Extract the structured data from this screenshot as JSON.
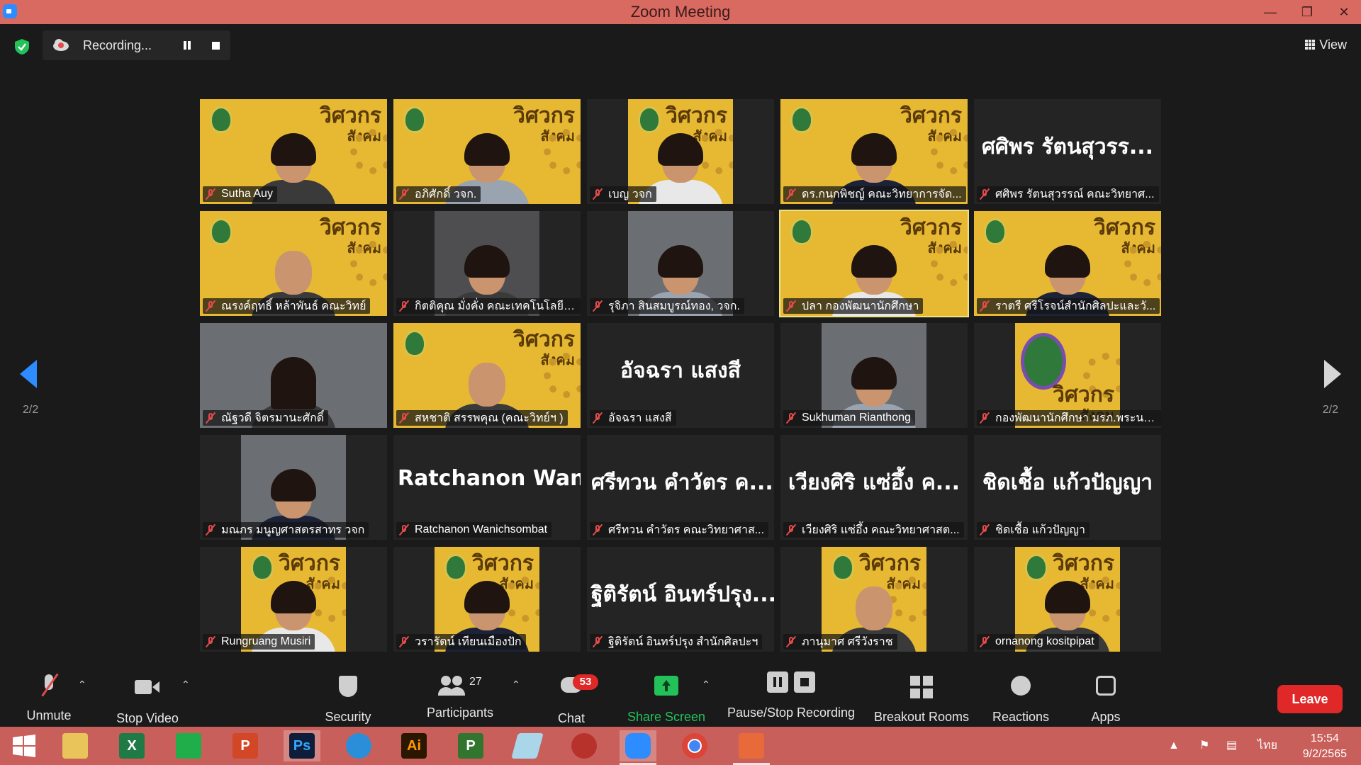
{
  "window": {
    "title": "Zoom Meeting"
  },
  "topbar": {
    "recording_label": "Recording...",
    "view_label": "View"
  },
  "tiles": [
    {
      "name": "Sutha Auy",
      "display": "video-yellow"
    },
    {
      "name": "อภิศักดิ์ วจก.",
      "display": "video-yellow"
    },
    {
      "name": "เบญ วจก",
      "display": "video-yellow-center"
    },
    {
      "name": "ดร.กนกพิชญ์ คณะวิทยาการจัด...",
      "display": "video-yellow"
    },
    {
      "name": "ศศิพร รัตนสุวรรณ์ คณะวิทยาศ...",
      "display": "name",
      "big": "ศศิพร รัตนสุวรร..."
    },
    {
      "name": "ณรงค์ฤทธิ์ หล้าพันธ์ คณะวิทย์",
      "display": "video-yellow"
    },
    {
      "name": "กิตติคุณ มั่งคั่ง คณะเทคโนโลยีอุ...",
      "display": "video-plain-center"
    },
    {
      "name": "รุจิภา สินสมบูรณ์ทอง, วจก.",
      "display": "video-dark-center"
    },
    {
      "name": "ปลา กองพัฒนานักศึกษา",
      "display": "video-yellow",
      "active": true
    },
    {
      "name": "ราตรี ศรีโรจน์สำนักศิลปะและวั...",
      "display": "video-yellow"
    },
    {
      "name": "ณัฐวดี จิตรมานะศักดิ์",
      "display": "video-dark"
    },
    {
      "name": "สหชาติ สรรพคุณ (คณะวิทย์ฯ )",
      "display": "video-yellow"
    },
    {
      "name": "อัจฉรา แสงสี",
      "display": "name",
      "big": "อัจฉรา แสงสี"
    },
    {
      "name": "Sukhuman Rianthong",
      "display": "video-dark-center"
    },
    {
      "name": "กองพัฒนานักศึกษา มรภ.พระนคร",
      "display": "logo-center"
    },
    {
      "name": "มณภร มนูญศาสตรสาทร วจก",
      "display": "video-dark-center"
    },
    {
      "name": "Ratchanon Wanichsombat",
      "display": "name",
      "big": "Ratchanon Wan..."
    },
    {
      "name": "ศรีทวน คำวัตร คณะวิทยาศาส...",
      "display": "name",
      "big": "ศรีทวน คำวัตร ค..."
    },
    {
      "name": "เวียงศิริ แซ่อึ้ง คณะวิทยาศาสต...",
      "display": "name",
      "big": "เวียงศิริ แซ่อึ้ง ค..."
    },
    {
      "name": "ชิดเชื้อ แก้วปัญญา",
      "display": "name",
      "big": "ชิดเชื้อ แก้วปัญญา"
    },
    {
      "name": "Rungruang Musiri",
      "display": "video-yellow-center"
    },
    {
      "name": "วรารัตน์ เทียนเมืองปัก",
      "display": "video-yellow-center"
    },
    {
      "name": "ฐิติรัตน์ อินทร์ปรุง สำนักศิลปะฯ",
      "display": "name",
      "big": "ฐิติรัตน์ อินทร์ปรุง..."
    },
    {
      "name": "ภานุมาศ ศรีวังราช",
      "display": "video-yellow-center"
    },
    {
      "name": "ornanong kositpipat",
      "display": "video-yellow-center"
    }
  ],
  "tile_bg_text": {
    "line1": "วิศวกร",
    "line2": "สังคม"
  },
  "pager": {
    "left": "2/2",
    "right": "2/2"
  },
  "toolbar": {
    "unmute": "Unmute",
    "stop_video": "Stop Video",
    "security": "Security",
    "participants": "Participants",
    "participants_count": "27",
    "chat": "Chat",
    "chat_badge": "53",
    "share_screen": "Share Screen",
    "pause_stop_recording": "Pause/Stop Recording",
    "breakout_rooms": "Breakout Rooms",
    "reactions": "Reactions",
    "apps": "Apps",
    "leave": "Leave"
  },
  "taskbar": {
    "apps": [
      "Windows",
      "File Explorer",
      "Excel",
      "Store",
      "PowerPoint",
      "Photoshop",
      "Internet Explorer",
      "Illustrator",
      "Project",
      "Notepad",
      "Photoscape",
      "Zoom",
      "Chrome",
      "Office"
    ],
    "app_letters": {
      "excel": "X",
      "ps": "Ps",
      "ai": "Ai",
      "ppt": "P",
      "project": "P"
    },
    "language": "ไทย",
    "time": "15:54",
    "date": "9/2/2565"
  },
  "colors": {
    "accent": "#2d8cff",
    "titlebar": "#d86a62",
    "taskbar": "#c95f5a",
    "leave": "#e02828",
    "share": "#23c15a",
    "tile_yellow": "#e7b933"
  }
}
